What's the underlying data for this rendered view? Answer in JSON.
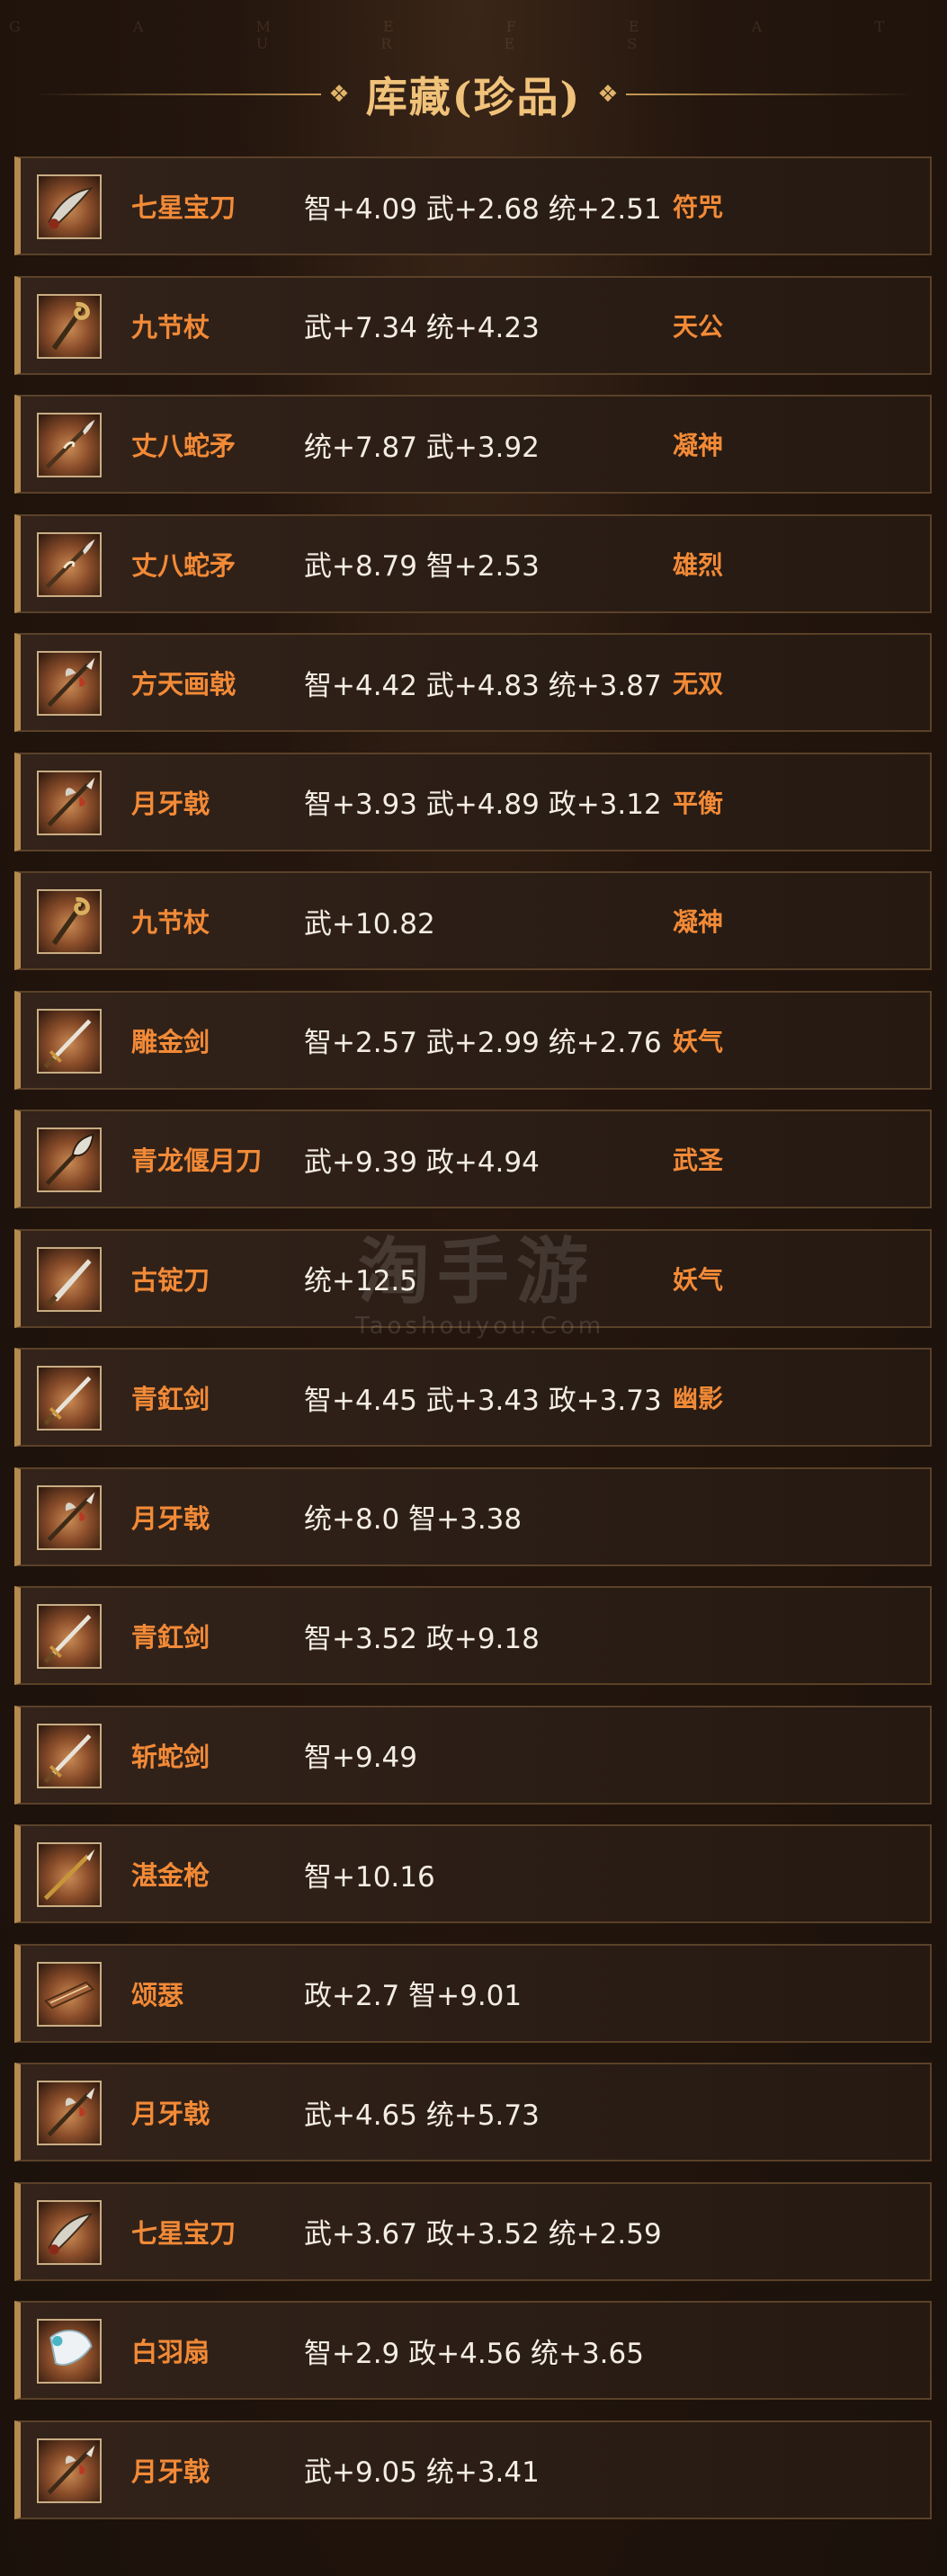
{
  "header": {
    "bg_text": "G A M E   F E A T U R E S",
    "title": "库藏(珍品)"
  },
  "watermark": {
    "main": "淘手游",
    "sub": "Taoshouyou.Com"
  },
  "items": [
    {
      "name": "七星宝刀",
      "stats": "智+4.09 武+2.68 统+2.51",
      "trait": "符咒",
      "icon": "saber-icon"
    },
    {
      "name": "九节杖",
      "stats": "武+7.34 统+4.23",
      "trait": "天公",
      "icon": "staff-icon"
    },
    {
      "name": "丈八蛇矛",
      "stats": "统+7.87 武+3.92",
      "trait": "凝神",
      "icon": "spear-icon"
    },
    {
      "name": "丈八蛇矛",
      "stats": "武+8.79 智+2.53",
      "trait": "雄烈",
      "icon": "spear-icon"
    },
    {
      "name": "方天画戟",
      "stats": "智+4.42 武+4.83 统+3.87",
      "trait": "无双",
      "icon": "halberd-icon"
    },
    {
      "name": "月牙戟",
      "stats": "智+3.93 武+4.89 政+3.12",
      "trait": "平衡",
      "icon": "halberd-icon"
    },
    {
      "name": "九节杖",
      "stats": "武+10.82",
      "trait": "凝神",
      "icon": "staff-icon"
    },
    {
      "name": "雕金剑",
      "stats": "智+2.57 武+2.99 统+2.76",
      "trait": "妖气",
      "icon": "sword-icon"
    },
    {
      "name": "青龙偃月刀",
      "stats": "武+9.39 政+4.94",
      "trait": "武圣",
      "icon": "glaive-icon"
    },
    {
      "name": "古锭刀",
      "stats": "统+12.5",
      "trait": "妖气",
      "icon": "blade-icon"
    },
    {
      "name": "青釭剑",
      "stats": "智+4.45 武+3.43 政+3.73",
      "trait": "幽影",
      "icon": "sword-icon"
    },
    {
      "name": "月牙戟",
      "stats": "统+8.0 智+3.38",
      "trait": "",
      "icon": "halberd-icon"
    },
    {
      "name": "青釭剑",
      "stats": "智+3.52 政+9.18",
      "trait": "",
      "icon": "sword-icon"
    },
    {
      "name": "斩蛇剑",
      "stats": "智+9.49",
      "trait": "",
      "icon": "sword-icon"
    },
    {
      "name": "湛金枪",
      "stats": "智+10.16",
      "trait": "",
      "icon": "lance-icon"
    },
    {
      "name": "颂瑟",
      "stats": "政+2.7 智+9.01",
      "trait": "",
      "icon": "zither-icon"
    },
    {
      "name": "月牙戟",
      "stats": "武+4.65 统+5.73",
      "trait": "",
      "icon": "halberd-icon"
    },
    {
      "name": "七星宝刀",
      "stats": "武+3.67 政+3.52 统+2.59",
      "trait": "",
      "icon": "saber-icon"
    },
    {
      "name": "白羽扇",
      "stats": "智+2.9 政+4.56 统+3.65",
      "trait": "",
      "icon": "fan-icon"
    },
    {
      "name": "月牙戟",
      "stats": "武+9.05 统+3.41",
      "trait": "",
      "icon": "halberd-icon"
    }
  ]
}
